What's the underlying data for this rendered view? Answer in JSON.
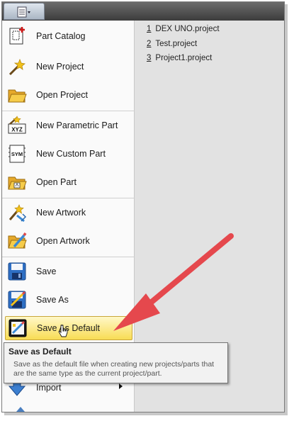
{
  "menu": {
    "items": [
      {
        "label": "Part Catalog",
        "icon": "part-catalog-icon"
      },
      {
        "label": "New Project",
        "icon": "new-project-icon"
      },
      {
        "label": "Open Project",
        "icon": "open-project-icon"
      },
      {
        "label": "New Parametric Part",
        "icon": "new-parametric-part-icon"
      },
      {
        "label": "New Custom Part",
        "icon": "new-custom-part-icon"
      },
      {
        "label": "Open Part",
        "icon": "open-part-icon"
      },
      {
        "label": "New Artwork",
        "icon": "new-artwork-icon"
      },
      {
        "label": "Open Artwork",
        "icon": "open-artwork-icon"
      },
      {
        "label": "Save",
        "icon": "save-icon"
      },
      {
        "label": "Save As",
        "icon": "save-as-icon"
      },
      {
        "label": "Save As Default",
        "icon": "save-as-default-icon"
      },
      {
        "label": "Import",
        "icon": "import-icon"
      }
    ],
    "highlighted": "Save As Default"
  },
  "recent": [
    {
      "num": "1",
      "name": "DEX UNO.project"
    },
    {
      "num": "2",
      "name": "Test.project"
    },
    {
      "num": "3",
      "name": "Project1.project"
    }
  ],
  "tooltip": {
    "title": "Save as Default",
    "description": "Save as the default file when creating new projects/parts that are the same type as the current project/part."
  },
  "icon_chips": {
    "xyz": "XYZ",
    "sym": "SYM"
  },
  "colors": {
    "highlight": "#f8dc54",
    "annotation_arrow": "#e5484d"
  }
}
